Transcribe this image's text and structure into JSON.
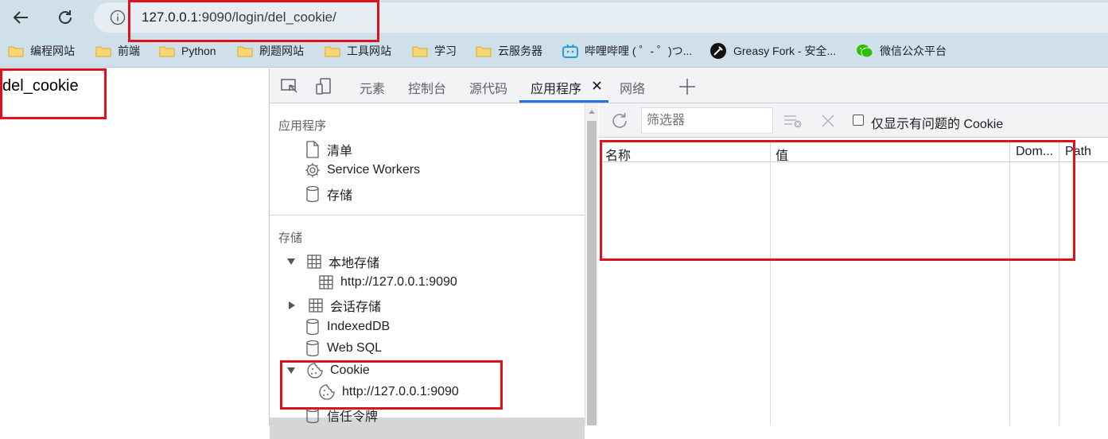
{
  "browser": {
    "url_host": "127.0.0.1",
    "url_rest": ":9090/login/del_cookie/",
    "bookmarks": [
      {
        "label": "编程网站",
        "icon": "folder-icon"
      },
      {
        "label": "前端",
        "icon": "folder-icon"
      },
      {
        "label": "Python",
        "icon": "folder-icon"
      },
      {
        "label": "刷题网站",
        "icon": "folder-icon"
      },
      {
        "label": "工具网站",
        "icon": "folder-icon"
      },
      {
        "label": "学习",
        "icon": "folder-icon"
      },
      {
        "label": "云服务器",
        "icon": "folder-icon"
      },
      {
        "label": "哔哩哔哩 ( ゜- ゜)つ...",
        "icon": "bilibili-icon"
      },
      {
        "label": "Greasy Fork - 安全...",
        "icon": "greasyfork-icon"
      },
      {
        "label": "微信公众平台",
        "icon": "wechat-icon"
      }
    ]
  },
  "page": {
    "text": "del_cookie"
  },
  "devtools": {
    "tabs": [
      "元素",
      "控制台",
      "源代码",
      "应用程序",
      "网络"
    ],
    "active_tab": "应用程序",
    "sidebar": {
      "app_section": "应用程序",
      "app_items": [
        "清单",
        "Service Workers",
        "存储"
      ],
      "storage_section": "存储",
      "local_storage": "本地存储",
      "local_storage_origin": "http://127.0.0.1:9090",
      "session_storage": "会话存储",
      "indexeddb": "IndexedDB",
      "websql": "Web SQL",
      "cookie": "Cookie",
      "cookie_origin": "http://127.0.0.1:9090",
      "trust_tokens": "信任令牌"
    },
    "cookies": {
      "filter_placeholder": "筛选器",
      "only_issues_label": "仅显示有问题的 Cookie",
      "columns": [
        "名称",
        "值",
        "Dom...",
        "Path"
      ]
    }
  },
  "colors": {
    "annotation": "#e0121c",
    "accent": "#1a73e8",
    "chrome_bg": "#cfe0ea"
  }
}
